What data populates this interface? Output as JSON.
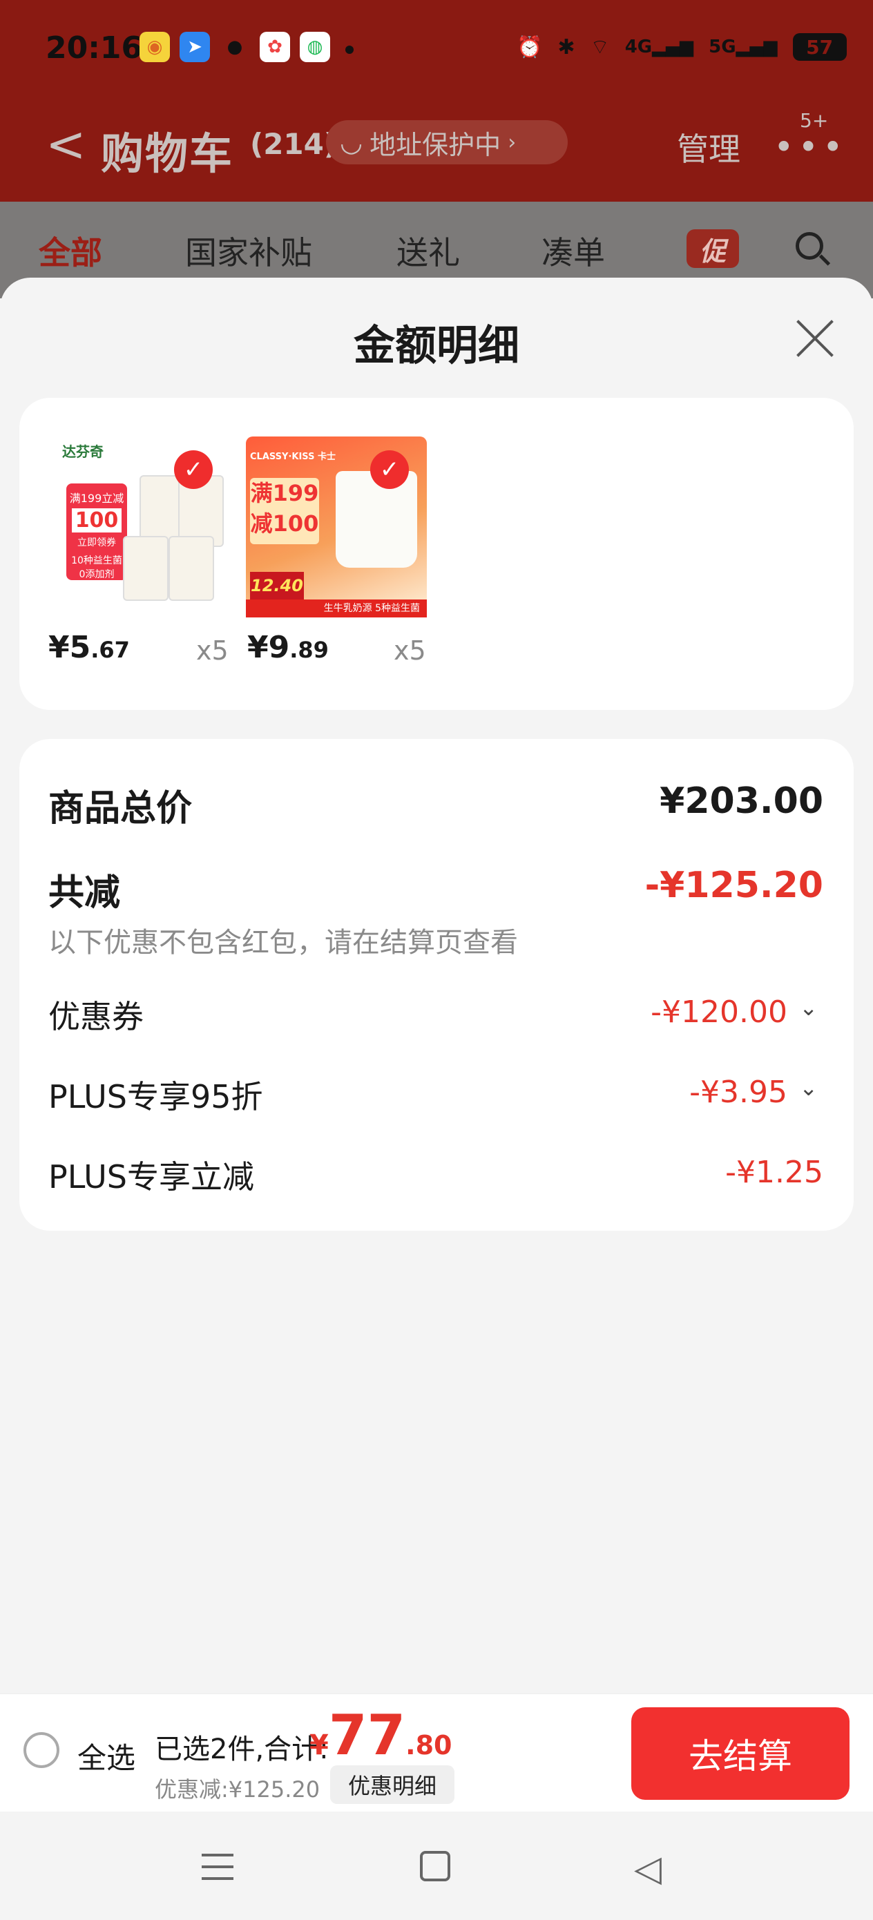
{
  "status": {
    "time": "20:16",
    "battery": "57",
    "network": [
      "4G",
      "5G"
    ]
  },
  "header": {
    "back": "<",
    "title": "购物车",
    "count": "(214)",
    "address_pill": "地址保护中",
    "manage": "管理",
    "more_badge": "5+"
  },
  "tabs": [
    {
      "label": "全部",
      "active": true
    },
    {
      "label": "国家补贴"
    },
    {
      "label": "送礼"
    },
    {
      "label": "凑单"
    },
    {
      "label": "促"
    }
  ],
  "sheet": {
    "title": "金额明细",
    "items": [
      {
        "price_int": "¥5",
        "price_dec": ".67",
        "qty": "x5",
        "img_text": {
          "brand": "达芬奇",
          "line1": "满199立减",
          "line2": "100",
          "line3": "立即领券",
          "line4": "10种益生菌",
          "line5": "0添加剂"
        }
      },
      {
        "price_int": "¥9",
        "price_dec": ".89",
        "qty": "x5",
        "img_text": {
          "brand": "CLASSY·KISS 卡士",
          "line1": "满199",
          "line2": "减100",
          "line3": "12.40",
          "line4": "生牛乳奶源 5种益生菌"
        }
      }
    ],
    "summary": {
      "total_label": "商品总价",
      "total_value": "¥203.00",
      "reduce_label": "共减",
      "reduce_value": "-¥125.20",
      "note": "以下优惠不包含红包，请在结算页查看",
      "rows": [
        {
          "label": "优惠券",
          "value": "-¥120.00",
          "expand": "⌄"
        },
        {
          "label": "PLUS专享95折",
          "value": "-¥3.95",
          "expand": "⌄"
        },
        {
          "label": "PLUS专享立减",
          "value": "-¥1.25",
          "expand": ""
        }
      ]
    }
  },
  "bottom": {
    "select_all": "全选",
    "selected": "已选2件,合计:",
    "currency": "¥",
    "total_int": "77",
    "total_dec": ".80",
    "discount": "优惠减:¥125.20",
    "detail_btn": "优惠明细",
    "checkout": "去结算"
  },
  "colors": {
    "accent": "#e5352b",
    "header_bg": "#8a1a12",
    "checkout_bg": "#f2302f"
  }
}
